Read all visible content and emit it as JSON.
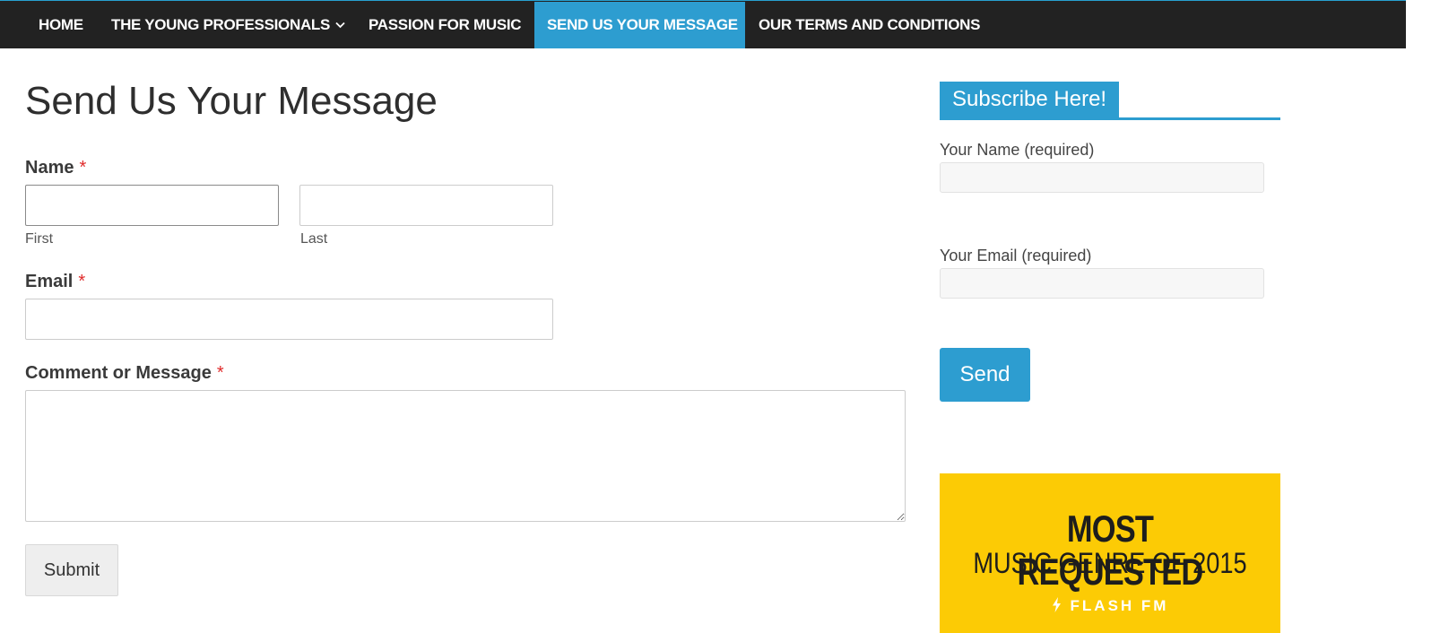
{
  "nav": {
    "items": [
      {
        "label": "HOME"
      },
      {
        "label": "THE YOUNG PROFESSIONALS"
      },
      {
        "label": "PASSION FOR MUSIC"
      },
      {
        "label": "SEND US YOUR MESSAGE",
        "active": true
      },
      {
        "label": "OUR TERMS AND CONDITIONS"
      }
    ],
    "dropdown_icon": "chevron-down-icon"
  },
  "colors": {
    "accent": "#2d9dd0",
    "nav_bg": "#222222",
    "required": "#e02b2b",
    "promo_bg": "#fccb05"
  },
  "form": {
    "title": "Send Us Your Message",
    "name_label": "Name",
    "required_mark": "*",
    "first_label": "First",
    "last_label": "Last",
    "first_value": "",
    "last_value": "",
    "email_label": "Email",
    "email_value": "",
    "message_label": "Comment or Message",
    "message_value": "",
    "submit_label": "Submit"
  },
  "sidebar": {
    "widget_title": "Subscribe Here!",
    "name_label": "Your Name (required)",
    "email_label": "Your Email (required)",
    "send_label": "Send",
    "promo": {
      "line1": "MOST REQUESTED",
      "line2": "MUSIC GENRE OF 2015",
      "brand": "FLASH FM",
      "brand_icon": "lightning-bolt-icon"
    }
  }
}
